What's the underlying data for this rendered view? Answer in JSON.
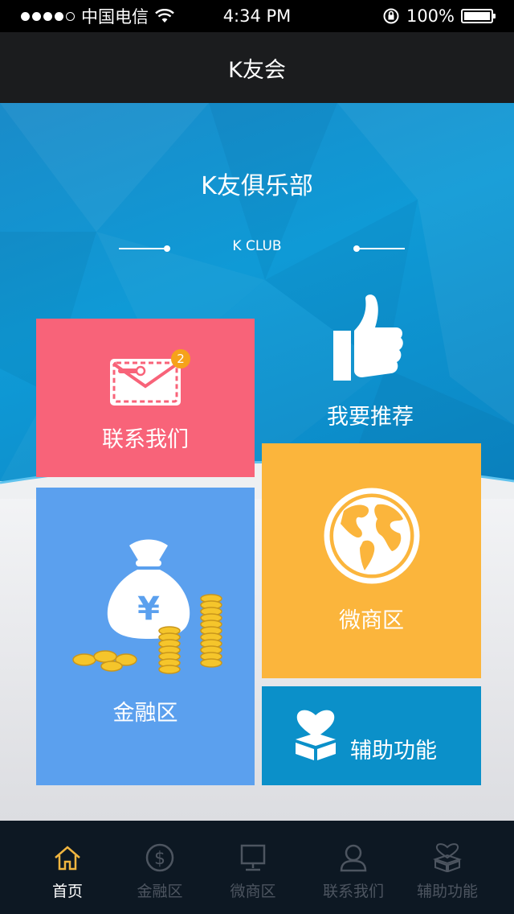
{
  "status_bar": {
    "carrier": "中国电信",
    "time": "4:34 PM",
    "battery": "100%"
  },
  "navbar": {
    "title": "K友会"
  },
  "hero": {
    "title": "K友俱乐部",
    "subtitle": "K CLUB"
  },
  "tiles": {
    "contact": {
      "label": "联系我们",
      "badge": "2"
    },
    "recommend": {
      "label": "我要推荐"
    },
    "micro_shop": {
      "label": "微商区"
    },
    "finance": {
      "label": "金融区"
    },
    "assist": {
      "label": "辅助功能"
    }
  },
  "tabbar": {
    "items": [
      {
        "label": "首页",
        "icon": "home-icon",
        "active": true
      },
      {
        "label": "金融区",
        "icon": "dollar-icon",
        "active": false
      },
      {
        "label": "微商区",
        "icon": "monitor-icon",
        "active": false
      },
      {
        "label": "联系我们",
        "icon": "user-icon",
        "active": false
      },
      {
        "label": "辅助功能",
        "icon": "heart-box-icon",
        "active": false
      }
    ]
  },
  "colors": {
    "contact_tile": "#f86379",
    "micro_tile": "#fbb53c",
    "finance_tile": "#5ba0ee",
    "assist_tile": "#0b90c9",
    "hero_blue": "#0f9ad6",
    "badge": "#f6a21a",
    "tab_active": "#f0b540"
  }
}
